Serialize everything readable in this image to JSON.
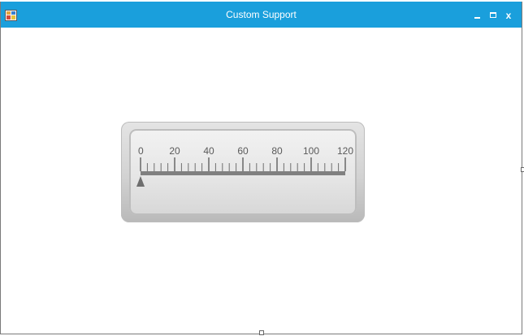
{
  "window": {
    "title": "Custom Support",
    "controls": {
      "minimize_icon": "minimize-icon",
      "maximize_icon": "maximize-icon",
      "close_label": "x"
    },
    "app_icon": "app-form-icon"
  },
  "gauge": {
    "type": "linear-gauge",
    "min": 0,
    "max": 120,
    "major_step": 20,
    "minor_per_major": 5,
    "tick_labels": [
      "0",
      "20",
      "40",
      "60",
      "80",
      "100",
      "120"
    ],
    "pointer_value": 0,
    "colors": {
      "bar": "#808080",
      "tick": "#707070",
      "label": "#5a5a5a",
      "pointer": "#6e6e6e"
    }
  },
  "colors": {
    "titlebar": "#1a9fdc",
    "title_text": "#ffffff"
  }
}
